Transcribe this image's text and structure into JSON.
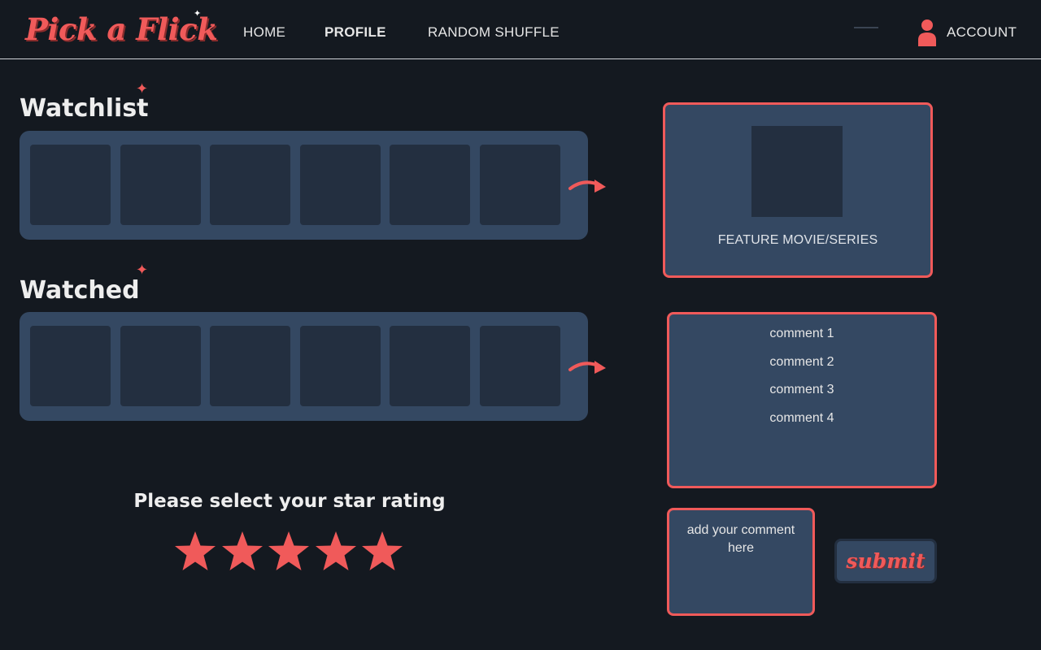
{
  "app": {
    "logo_text": "Pick a Flick"
  },
  "nav": {
    "items": [
      {
        "label": "HOME",
        "active": false
      },
      {
        "label": "PROFILE",
        "active": true
      },
      {
        "label": "RANDOM SHUFFLE",
        "active": false
      }
    ],
    "account_label": "ACCOUNT",
    "account_icon": "user-icon"
  },
  "sections": {
    "watchlist": {
      "title": "Watchlist",
      "poster_count": 6
    },
    "watched": {
      "title": "Watched",
      "poster_count": 6
    }
  },
  "feature": {
    "label": "FEATURE MOVIE/SERIES"
  },
  "comments": {
    "items": [
      "comment 1",
      "comment 2",
      "comment 3",
      "comment 4"
    ],
    "input_placeholder": "add your comment here",
    "submit_label": "submit"
  },
  "rating": {
    "prompt": "Please select your star rating",
    "max_stars": 5,
    "filled_stars": 5
  },
  "colors": {
    "background": "#141920",
    "panel": "#344862",
    "poster": "#232f40",
    "accent": "#f05a5a",
    "text": "#e6e6e6"
  }
}
